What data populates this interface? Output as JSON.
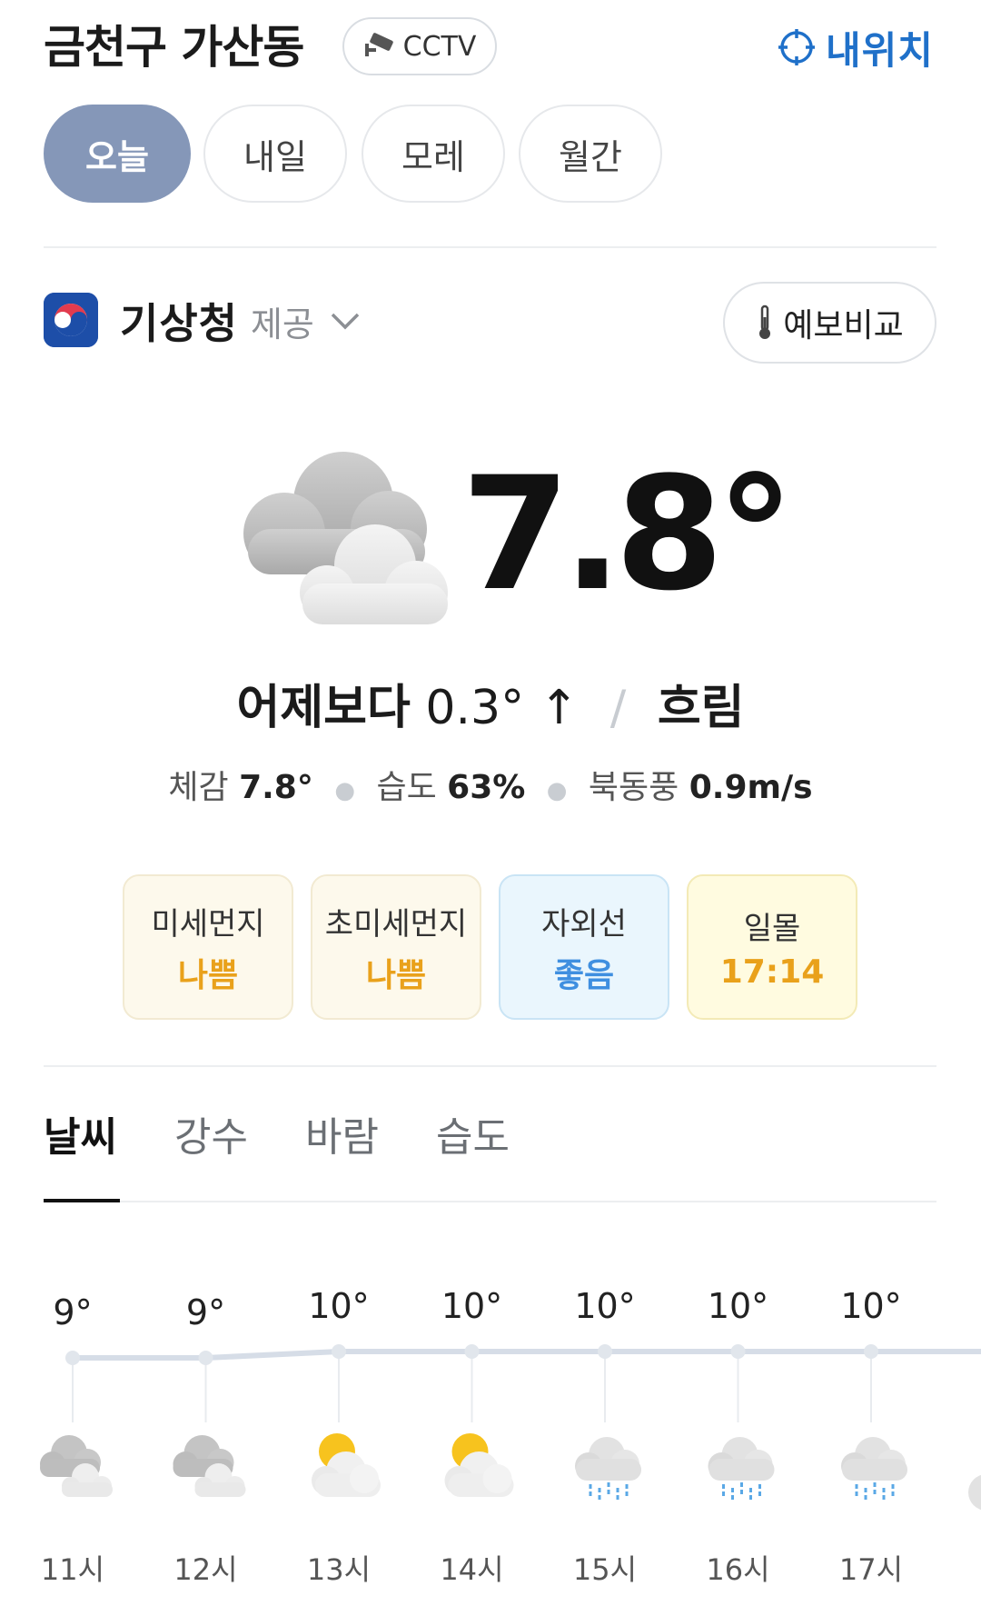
{
  "header": {
    "location": "금천구 가산동",
    "cctv_label": "CCTV",
    "my_location_label": "내위치"
  },
  "day_tabs": [
    {
      "label": "오늘",
      "active": true
    },
    {
      "label": "내일",
      "active": false
    },
    {
      "label": "모레",
      "active": false
    },
    {
      "label": "월간",
      "active": false
    }
  ],
  "provider": {
    "name": "기상청",
    "suffix": "제공",
    "compare_label": "예보비교"
  },
  "current": {
    "icon": "cloudy-icon",
    "temperature": "7.8°",
    "compare_prefix": "어제보다",
    "compare_value": "0.3°",
    "compare_arrow": "↑",
    "condition": "흐림",
    "feels_label": "체감",
    "feels_value": "7.8°",
    "humidity_label": "습도",
    "humidity_value": "63%",
    "wind_label": "북동풍",
    "wind_value": "0.9m/s"
  },
  "cards": [
    {
      "label": "미세먼지",
      "value": "나쁨",
      "value_color": "#e9a11b",
      "bg": "#fdf9ec",
      "border": "#f2ead2"
    },
    {
      "label": "초미세먼지",
      "value": "나쁨",
      "value_color": "#e9a11b",
      "bg": "#fdf9ec",
      "border": "#f2ead2"
    },
    {
      "label": "자외선",
      "value": "좋음",
      "value_color": "#3f8fe0",
      "bg": "#eaf6fd",
      "border": "#c9e4f5"
    },
    {
      "label": "일몰",
      "value": "17:14",
      "value_color": "#e9a11b",
      "bg": "#fffbe0",
      "border": "#f3eab6"
    }
  ],
  "chart_tabs": [
    {
      "label": "날씨",
      "active": true
    },
    {
      "label": "강수",
      "active": false
    },
    {
      "label": "바람",
      "active": false
    },
    {
      "label": "습도",
      "active": false
    }
  ],
  "chart_data": {
    "type": "line",
    "x": [
      "11시",
      "12시",
      "13시",
      "14시",
      "15시",
      "16시",
      "17시"
    ],
    "series": [
      {
        "values": [
          9,
          9,
          10,
          10,
          10,
          10,
          10
        ]
      }
    ],
    "temp_labels": [
      "9°",
      "9°",
      "10°",
      "10°",
      "10°",
      "10°",
      "10°"
    ],
    "icons": [
      "cloudy-icon",
      "cloudy-icon",
      "partly-sunny-icon",
      "partly-sunny-icon",
      "rain-icon",
      "rain-icon",
      "rain-icon"
    ]
  },
  "colors": {
    "accent_blue": "#1f70c9",
    "active_tab_bg": "#8597b8",
    "line": "#d6dde7"
  }
}
